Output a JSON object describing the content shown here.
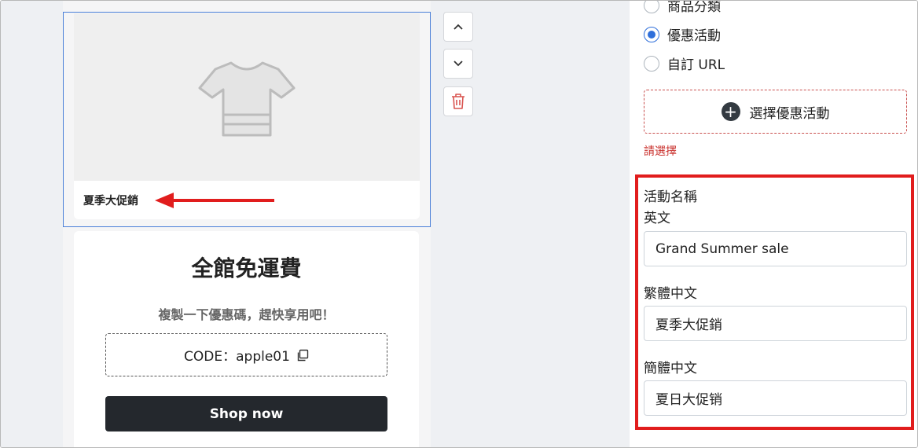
{
  "preview": {
    "selected_block": {
      "title": "夏季大促銷"
    },
    "controls": {
      "up_icon": "chevron-up-icon",
      "down_icon": "chevron-down-icon",
      "delete_icon": "trash-icon"
    },
    "promo_card": {
      "title": "全館免運費",
      "subtitle": "複製一下優惠碼，趕快享用吧！",
      "code_text": "CODE：apple01",
      "copy_icon": "copy-icon",
      "button_label": "Shop now"
    }
  },
  "panel": {
    "radio_options": [
      {
        "label": "商品分類",
        "checked": false
      },
      {
        "label": "優惠活動",
        "checked": true
      },
      {
        "label": "自訂 URL",
        "checked": false
      }
    ],
    "select_button_label": "選擇優惠活動",
    "error_text": "請選擇",
    "activity_name_label": "活動名稱",
    "fields": [
      {
        "label": "英文",
        "value": "Grand Summer sale"
      },
      {
        "label": "繁體中文",
        "value": "夏季大促銷"
      },
      {
        "label": "簡體中文",
        "value": "夏日大促销"
      }
    ]
  },
  "colors": {
    "accent_blue": "#4a7fd8",
    "error_red": "#c9302c",
    "highlight_red": "#e11d1d",
    "button_dark": "#24282d"
  }
}
